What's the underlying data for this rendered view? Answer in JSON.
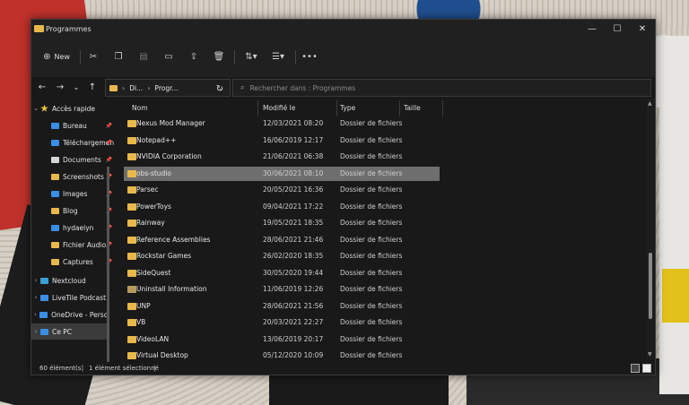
{
  "window": {
    "title": "Programmes",
    "controls": [
      "—",
      "☐",
      "✕"
    ]
  },
  "toolbar": {
    "new_label": "New",
    "icons": [
      "cut-icon",
      "copy-icon",
      "paste-icon",
      "rename-icon",
      "share-icon",
      "delete-icon",
      "sort-icon",
      "view-icon",
      "more-icon"
    ]
  },
  "address": {
    "path_segments": [
      "Di...",
      "Progr..."
    ],
    "search_placeholder": "Rechercher dans : Programmes"
  },
  "sidebar": {
    "quick_access": "Accès rapide",
    "items": [
      {
        "label": "Bureau",
        "color": "#3a8ee6"
      },
      {
        "label": "Téléchargemen",
        "color": "#3a8ee6"
      },
      {
        "label": "Documents",
        "color": "#d6d6d6"
      },
      {
        "label": "Screenshots",
        "color": "#e8b84a"
      },
      {
        "label": "Images",
        "color": "#3a8ee6"
      },
      {
        "label": "Blog",
        "color": "#e8b84a"
      },
      {
        "label": "hydaelyn",
        "color": "#3a8ee6"
      },
      {
        "label": "Fichier Audio",
        "color": "#e8b84a"
      },
      {
        "label": "Captures",
        "color": "#e8b84a"
      }
    ],
    "others": [
      {
        "label": "Nextcloud",
        "color": "#3aa0d8"
      },
      {
        "label": "LiveTile Podcast",
        "color": "#3a8ee6"
      },
      {
        "label": "OneDrive - Person",
        "color": "#3a8ee6"
      },
      {
        "label": "Ce PC",
        "color": "#3a8ee6"
      }
    ]
  },
  "columns": {
    "name": "Nom",
    "modified": "Modifié le",
    "type": "Type",
    "size": "Taille"
  },
  "files": [
    {
      "name": "Nexus Mod Manager",
      "date": "12/03/2021 08:20",
      "type": "Dossier de fichiers"
    },
    {
      "name": "Notepad++",
      "date": "16/06/2019 12:17",
      "type": "Dossier de fichiers"
    },
    {
      "name": "NVIDIA Corporation",
      "date": "21/06/2021 06:38",
      "type": "Dossier de fichiers"
    },
    {
      "name": "obs-studio",
      "date": "30/06/2021 08:10",
      "type": "Dossier de fichiers"
    },
    {
      "name": "Parsec",
      "date": "20/05/2021 16:36",
      "type": "Dossier de fichiers"
    },
    {
      "name": "PowerToys",
      "date": "09/04/2021 17:22",
      "type": "Dossier de fichiers"
    },
    {
      "name": "Rainway",
      "date": "19/05/2021 18:35",
      "type": "Dossier de fichiers"
    },
    {
      "name": "Reference Assemblies",
      "date": "28/06/2021 21:46",
      "type": "Dossier de fichiers"
    },
    {
      "name": "Rockstar Games",
      "date": "26/02/2020 18:35",
      "type": "Dossier de fichiers"
    },
    {
      "name": "SideQuest",
      "date": "30/05/2020 19:44",
      "type": "Dossier de fichiers"
    },
    {
      "name": "Uninstall Information",
      "date": "11/06/2019 12:26",
      "type": "Dossier de fichiers"
    },
    {
      "name": "UNP",
      "date": "28/06/2021 21:56",
      "type": "Dossier de fichiers"
    },
    {
      "name": "VB",
      "date": "20/03/2021 22:27",
      "type": "Dossier de fichiers"
    },
    {
      "name": "VideoLAN",
      "date": "13/06/2019 20:17",
      "type": "Dossier de fichiers"
    },
    {
      "name": "Virtual Desktop",
      "date": "05/12/2020 10:09",
      "type": "Dossier de fichiers"
    }
  ],
  "selected_file": "obs-studio",
  "status": {
    "count": "60 élément(s)",
    "selected": "1 élément sélectionné"
  }
}
